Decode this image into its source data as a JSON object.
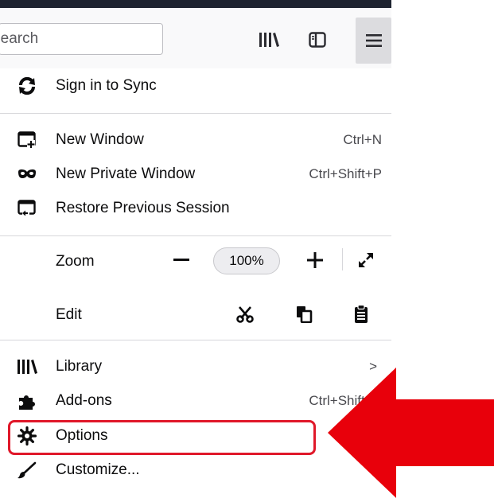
{
  "toolbar": {
    "search_text": "Search",
    "icons": [
      "library-icon",
      "sidebar-icon",
      "hamburger-menu-icon"
    ]
  },
  "menu": {
    "sign_in": "Sign in to Sync",
    "new_window": {
      "label": "New Window",
      "shortcut": "Ctrl+N"
    },
    "new_private_window": {
      "label": "New Private Window",
      "shortcut": "Ctrl+Shift+P"
    },
    "restore_session": "Restore Previous Session",
    "zoom": {
      "label": "Zoom",
      "minus": "−",
      "level": "100%",
      "plus": "+"
    },
    "edit": "Edit",
    "library": {
      "label": "Library",
      "chevron": ">"
    },
    "addons": {
      "label": "Add-ons",
      "shortcut": "Ctrl+Shift+A"
    },
    "options": "Options",
    "customize": "Customize..."
  },
  "annotation": {
    "highlight_color": "#e0182a",
    "arrow_color": "#e8000b"
  }
}
